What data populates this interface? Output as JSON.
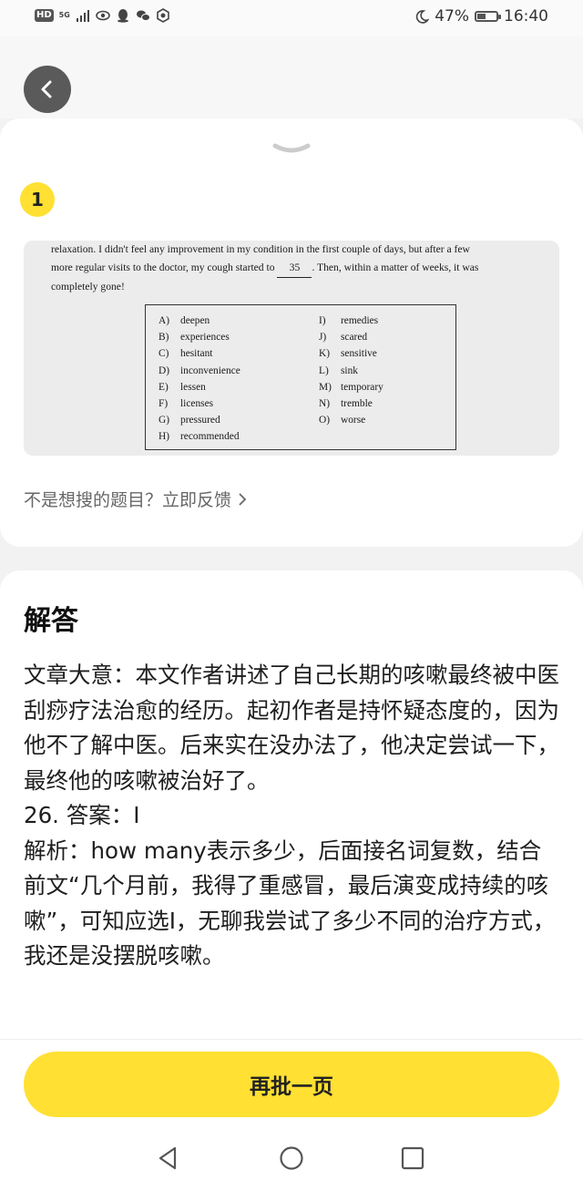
{
  "status_bar": {
    "hd": "HD",
    "network": "5G",
    "battery_pct": "47%",
    "battery_level": 0.47,
    "time": "16:40"
  },
  "question": {
    "number": "1",
    "passage_lines": [
      "relaxation. I didn't feel any improvement in my condition in the first couple of days, but after a few",
      "more regular visits to the doctor, my cough started to",
      ". Then, within a matter of weeks, it was",
      "completely gone!"
    ],
    "blank_number": "35",
    "options_left": [
      {
        "letter": "A)",
        "word": "deepen"
      },
      {
        "letter": "B)",
        "word": "experiences"
      },
      {
        "letter": "C)",
        "word": "hesitant"
      },
      {
        "letter": "D)",
        "word": "inconvenience"
      },
      {
        "letter": "E)",
        "word": "lessen"
      },
      {
        "letter": "F)",
        "word": "licenses"
      },
      {
        "letter": "G)",
        "word": "pressured"
      },
      {
        "letter": "H)",
        "word": "recommended"
      }
    ],
    "options_right": [
      {
        "letter": "I)",
        "word": "remedies"
      },
      {
        "letter": "J)",
        "word": "scared"
      },
      {
        "letter": "K)",
        "word": "sensitive"
      },
      {
        "letter": "L)",
        "word": "sink"
      },
      {
        "letter": "M)",
        "word": "temporary"
      },
      {
        "letter": "N)",
        "word": "tremble"
      },
      {
        "letter": "O)",
        "word": "worse"
      }
    ],
    "feedback_link": "不是想搜的题目？立即反馈"
  },
  "answer": {
    "title": "解答",
    "paragraphs": [
      "文章大意：本文作者讲述了自己长期的咳嗽最终被中医刮痧疗法治愈的经历。起初作者是持怀疑态度的，因为他不了解中医。后来实在没办法了，他决定尝试一下，最终他的咳嗽被治好了。",
      "26. 答案：I",
      "解析：how many表示多少，后面接名词复数，结合前文“几个月前，我得了重感冒，最后演变成持续的咳嗽”，可知应选I，无聊我尝试了多少不同的治疗方式，我还是没摆脱咳嗽。"
    ]
  },
  "cta_label": "再批一页"
}
